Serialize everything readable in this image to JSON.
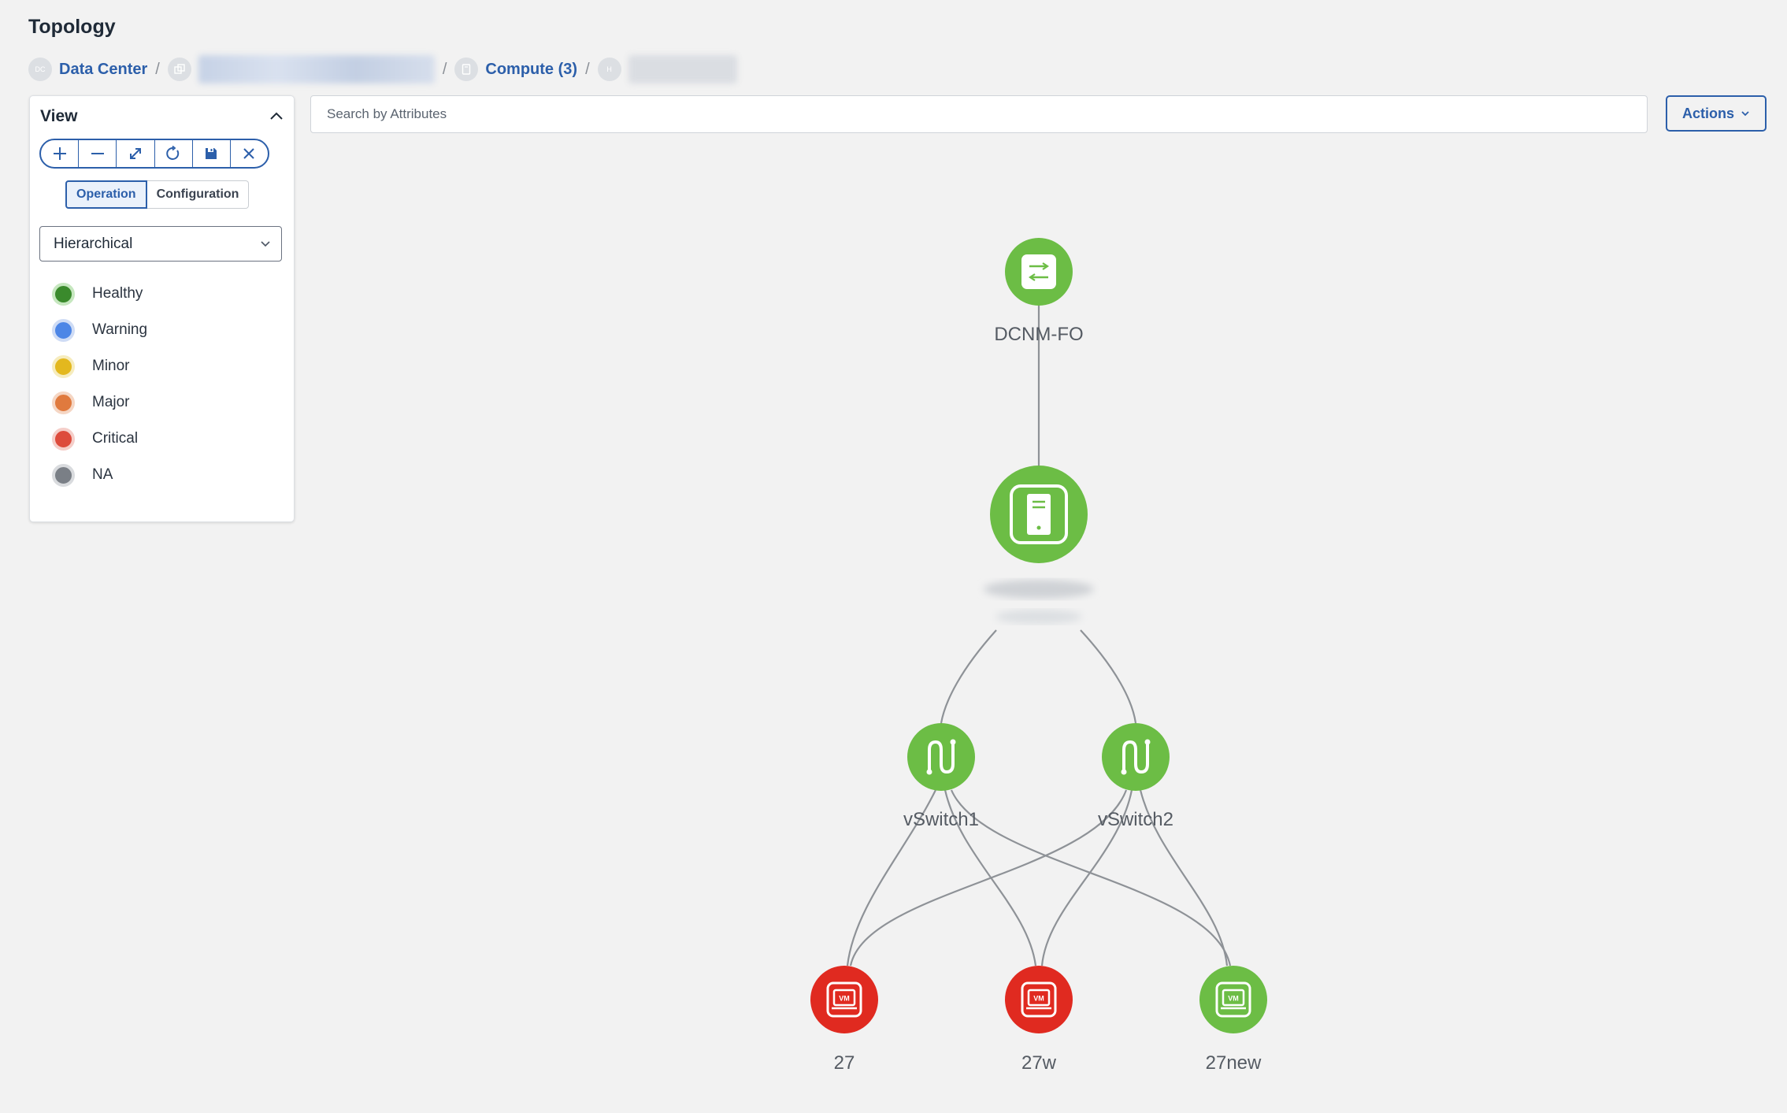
{
  "page": {
    "title": "Topology"
  },
  "breadcrumb": {
    "items": [
      {
        "icon_text": "DC",
        "label": "Data Center"
      },
      {
        "icon_text": "",
        "label": ""
      },
      {
        "icon_text": "",
        "label": "Compute (3)"
      },
      {
        "icon_text": "H",
        "label": ""
      }
    ],
    "separator": "/"
  },
  "view_panel": {
    "title": "View",
    "toolbar": [
      "zoom-in",
      "zoom-out",
      "fit-to-screen",
      "refresh",
      "save",
      "clear"
    ],
    "modes": {
      "operation": "Operation",
      "configuration": "Configuration",
      "selected": "Operation"
    },
    "layout": {
      "selected": "Hierarchical"
    },
    "legend": [
      {
        "label": "Healthy",
        "color": "#3a8a2c",
        "ring": "#c6e7bf"
      },
      {
        "label": "Warning",
        "color": "#4d86e6",
        "ring": "#cfdcf5"
      },
      {
        "label": "Minor",
        "color": "#e3b81e",
        "ring": "#f6ecbe"
      },
      {
        "label": "Major",
        "color": "#e07a3e",
        "ring": "#f5d6c4"
      },
      {
        "label": "Critical",
        "color": "#dd4b3c",
        "ring": "#f5cec9"
      },
      {
        "label": "NA",
        "color": "#7a7f86",
        "ring": "#d9dbde"
      }
    ]
  },
  "search": {
    "placeholder": "Search by Attributes",
    "value": ""
  },
  "actions": {
    "label": "Actions"
  },
  "topology": {
    "colors": {
      "healthy": "#6cbd45",
      "critical": "#e02a20",
      "edge": "#8e9297"
    },
    "nodes": [
      {
        "id": "dcnm",
        "label": "DCNM-FO",
        "status": "healthy",
        "icon": "network-switch-icon"
      },
      {
        "id": "host",
        "label": "",
        "status": "healthy",
        "icon": "host-server-icon"
      },
      {
        "id": "vs1",
        "label": "vSwitch1",
        "status": "healthy",
        "icon": "vswitch-icon"
      },
      {
        "id": "vs2",
        "label": "vSwitch2",
        "status": "healthy",
        "icon": "vswitch-icon"
      },
      {
        "id": "vm27",
        "label": "27",
        "status": "critical",
        "icon": "vm-icon"
      },
      {
        "id": "vm27w",
        "label": "27w",
        "status": "critical",
        "icon": "vm-icon"
      },
      {
        "id": "vm27new",
        "label": "27new",
        "status": "healthy",
        "icon": "vm-icon"
      }
    ],
    "vm_badge": "VM"
  }
}
